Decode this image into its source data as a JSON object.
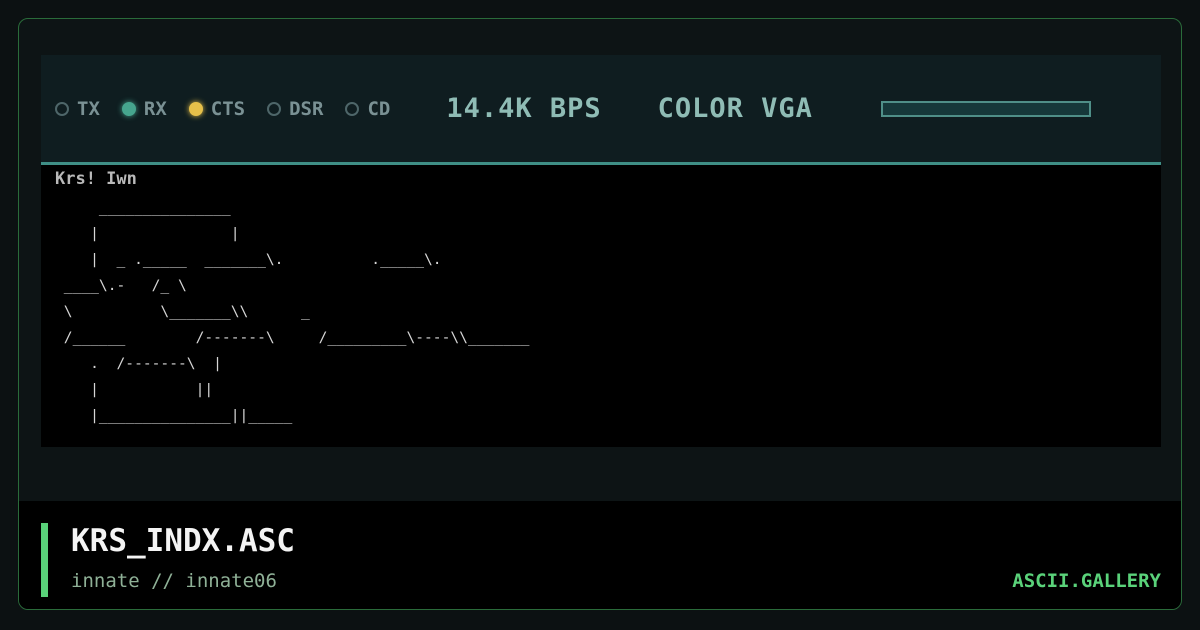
{
  "status_bar": {
    "indicators": [
      {
        "label": "TX",
        "state": "off",
        "color": "#4e6669"
      },
      {
        "label": "RX",
        "state": "on",
        "color": "#46a58e"
      },
      {
        "label": "CTS",
        "state": "on",
        "color": "#e6c04a"
      },
      {
        "label": "DSR",
        "state": "off",
        "color": "#4e6669"
      },
      {
        "label": "CD",
        "state": "off",
        "color": "#4e6669"
      }
    ],
    "baud": "14.4K BPS",
    "mode": "COLOR VGA",
    "progress": 0.0
  },
  "terminal": {
    "header": "Krs! Iwn",
    "ascii": "     _______________\n    |               |\n    |  _ ._____  _______\\.          ._____\\.\n ____\\.-   /_ \\                                 \n \\          \\_______\\\\      _\n /______        /-------\\     /_________\\----\\\\_______\n    .  /-------\\  |\n    |           ||\n    |_______________||_____"
  },
  "footer": {
    "title": "KRS_INDX.ASC",
    "subtitle": "innate // innate06",
    "brand": "ASCII.GALLERY",
    "accent_color": "#5ad27a"
  }
}
